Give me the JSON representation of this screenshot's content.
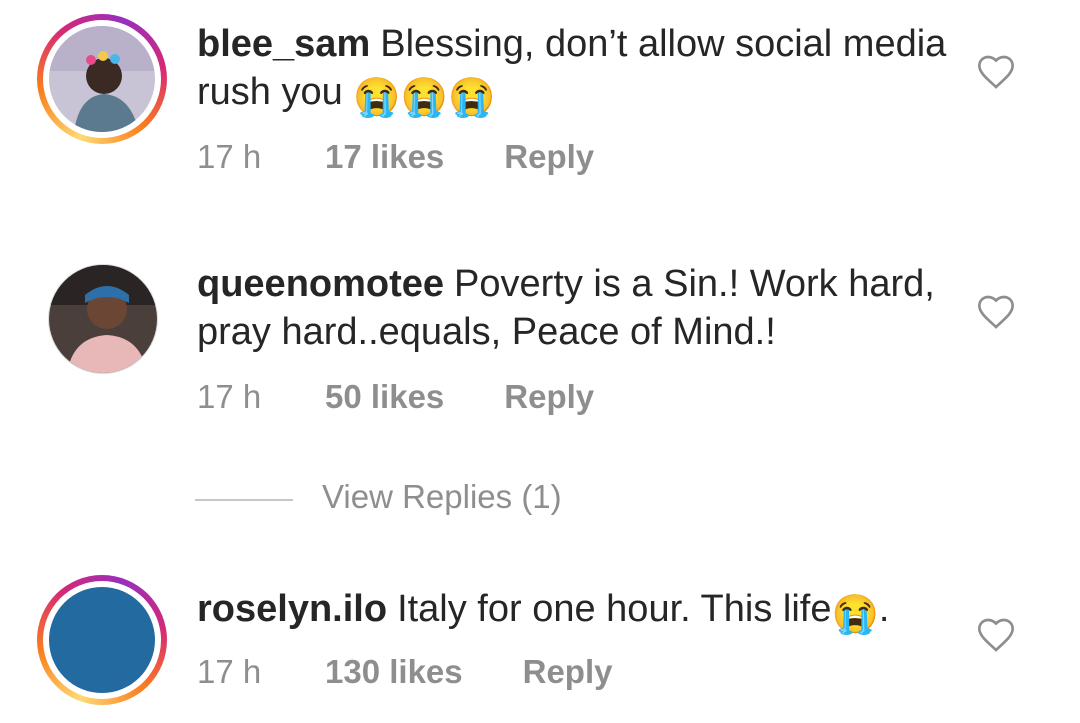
{
  "comments": [
    {
      "username": "blee_sam",
      "text": "Blessing, don’t allow social media rush you",
      "emojis": "😭😭😭",
      "time": "17 h",
      "likes": "17 likes",
      "reply": "Reply",
      "story_ring": true
    },
    {
      "username": "queenomotee",
      "text": "Poverty is a Sin.! Work hard, pray hard..equals, Peace of Mind.!",
      "emojis": "",
      "time": "17 h",
      "likes": "50 likes",
      "reply": "Reply",
      "story_ring": false
    },
    {
      "username": "roselyn.ilo",
      "text": "Italy for one hour. This life",
      "emojis": "😭",
      "trailing": ".",
      "time": "17 h",
      "likes": "130 likes",
      "reply": "Reply",
      "story_ring": true
    }
  ],
  "view_replies": "View Replies (1)",
  "icons": {
    "like": "heart-outline-icon",
    "emoji": "loudly-crying-face-emoji"
  },
  "colors": {
    "text": "#262626",
    "meta": "#8e8e8e",
    "avatar_blue": "#236aa0"
  }
}
